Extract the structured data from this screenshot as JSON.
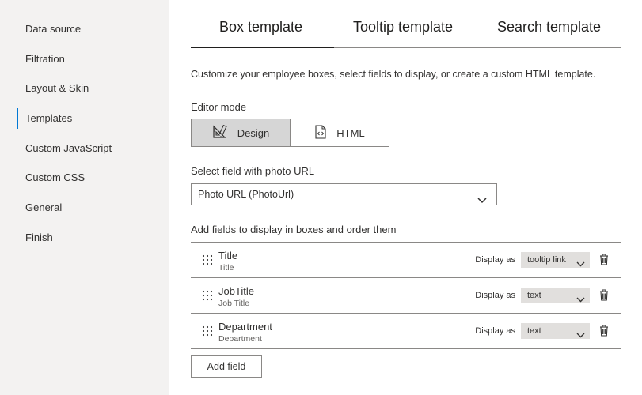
{
  "sidebar": {
    "items": [
      {
        "label": "Data source"
      },
      {
        "label": "Filtration"
      },
      {
        "label": "Layout & Skin"
      },
      {
        "label": "Templates"
      },
      {
        "label": "Custom JavaScript"
      },
      {
        "label": "Custom CSS"
      },
      {
        "label": "General"
      },
      {
        "label": "Finish"
      }
    ],
    "active": "Templates"
  },
  "tabs": [
    {
      "label": "Box template"
    },
    {
      "label": "Tooltip template"
    },
    {
      "label": "Search template"
    }
  ],
  "description": "Customize your employee boxes, select fields to display, or create a custom HTML template.",
  "editor_mode": {
    "label": "Editor mode",
    "design_label": "Design",
    "html_label": "HTML",
    "selected": "Design"
  },
  "photo_field": {
    "label": "Select field with photo URL",
    "value": "Photo URL (PhotoUrl)"
  },
  "fields_section": {
    "title": "Add fields to display in boxes and order them",
    "display_as_label": "Display as",
    "rows": [
      {
        "name": "Title",
        "sub": "Title",
        "display": "tooltip link"
      },
      {
        "name": "JobTitle",
        "sub": "Job Title",
        "display": "text"
      },
      {
        "name": "Department",
        "sub": "Department",
        "display": "text"
      }
    ]
  },
  "add_field_label": "Add field",
  "colors": {
    "accent": "#0078d4",
    "sidebar_bg": "#f3f2f1",
    "selected_bg": "#d6d6d6"
  }
}
